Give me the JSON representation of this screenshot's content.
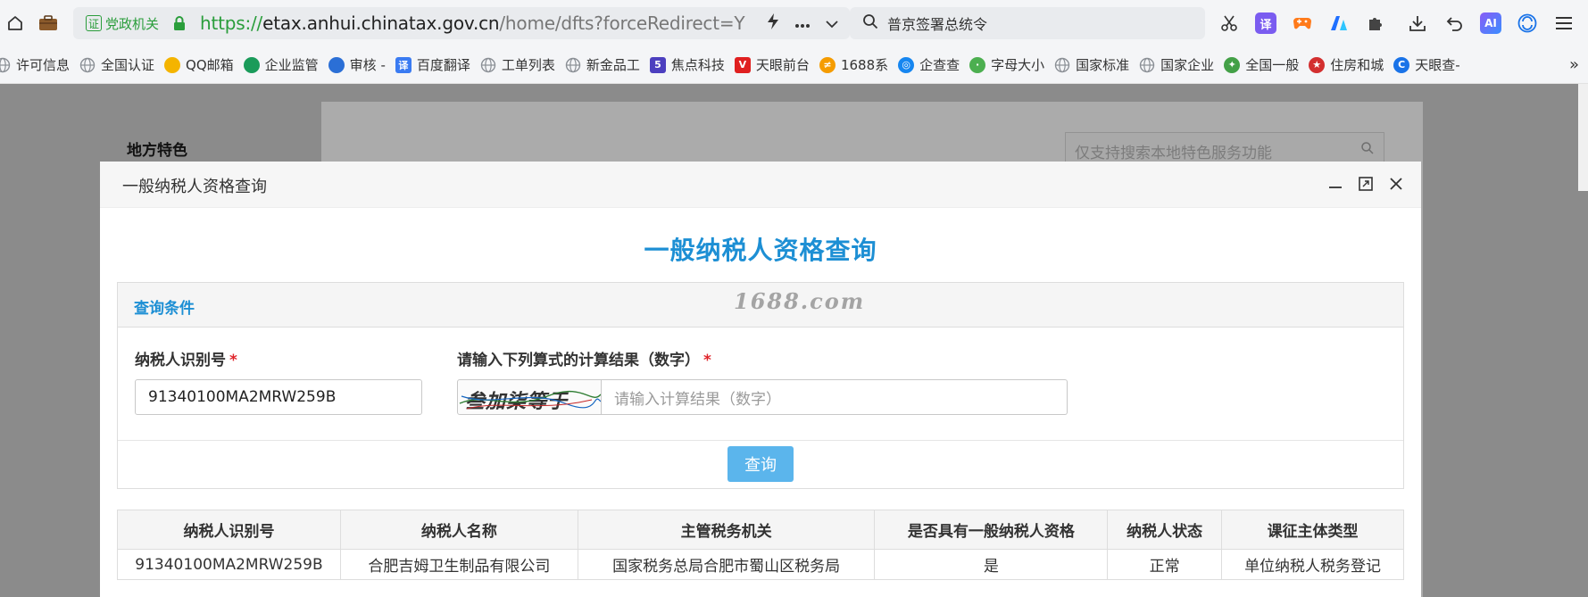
{
  "browser": {
    "cert_label": "党政机关",
    "cert_badge": "证",
    "url": {
      "scheme": "https://",
      "host": "etax.anhui.chinatax.gov.cn",
      "path": "/home/dfts?forceRedirect=Y"
    },
    "search_text": "普京签署总统令",
    "ext_translate": "译",
    "ext_ai": "AI",
    "bookmarks": [
      {
        "label": "许可信息",
        "icon": "globe-icon",
        "color": "#9aa0a6",
        "glyph": ""
      },
      {
        "label": "全国认证",
        "icon": "globe-icon",
        "color": "#9aa0a6",
        "glyph": ""
      },
      {
        "label": "QQ邮箱",
        "icon": "qq-mail-icon",
        "color": "#f4b400",
        "glyph": ""
      },
      {
        "label": "企业监管",
        "icon": "swirl-icon",
        "color": "#1a9b5a",
        "glyph": ""
      },
      {
        "label": "审核 -",
        "icon": "triangle-icon",
        "color": "#2b6fd6",
        "glyph": ""
      },
      {
        "label": "百度翻译",
        "icon": "translate-icon",
        "color": "#3a7bf2",
        "glyph": "译"
      },
      {
        "label": "工单列表",
        "icon": "globe-icon",
        "color": "#9aa0a6",
        "glyph": ""
      },
      {
        "label": "新金品工",
        "icon": "globe-icon",
        "color": "#9aa0a6",
        "glyph": ""
      },
      {
        "label": "焦点科技",
        "icon": "focus-icon",
        "color": "#4c3fbf",
        "glyph": "5"
      },
      {
        "label": "天眼前台",
        "icon": "v-icon",
        "color": "#e02020",
        "glyph": "V"
      },
      {
        "label": "1688系",
        "icon": "1688-icon",
        "color": "#f59c00",
        "glyph": "≠"
      },
      {
        "label": "企查查",
        "icon": "qcc-icon",
        "color": "#1686f0",
        "glyph": "◎"
      },
      {
        "label": "字母大小",
        "icon": "frog-icon",
        "color": "#4caf50",
        "glyph": "·"
      },
      {
        "label": "国家标准",
        "icon": "globe-icon",
        "color": "#9aa0a6",
        "glyph": ""
      },
      {
        "label": "国家企业",
        "icon": "globe-icon",
        "color": "#9aa0a6",
        "glyph": ""
      },
      {
        "label": "全国一般",
        "icon": "plant-icon",
        "color": "#43a047",
        "glyph": "✦"
      },
      {
        "label": "住房和城",
        "icon": "emblem-icon",
        "color": "#d32f2f",
        "glyph": "★"
      },
      {
        "label": "天眼查-",
        "icon": "tianyan-icon",
        "color": "#1a73e8",
        "glyph": "C"
      }
    ],
    "bookmarks_more": "»"
  },
  "background_page": {
    "side_title": "地方特色",
    "search_placeholder": "仅支持搜索本地特色服务功能"
  },
  "dialog": {
    "window_title": "一般纳税人资格查询",
    "heading": "一般纳税人资格查询",
    "panel_title": "查询条件",
    "watermark": "1688.com",
    "taxpayer_id_label": "纳税人识别号",
    "taxpayer_id_value": "91340100MA2MRW259B",
    "captcha_label": "请输入下列算式的计算结果（数字）",
    "captcha_image_text": "叁加柒等于",
    "captcha_placeholder": "请输入计算结果（数字）",
    "required_mark": "*",
    "query_button": "查询",
    "accent_color": "#1d8fd4"
  },
  "result_table": {
    "headers": [
      "纳税人识别号",
      "纳税人名称",
      "主管税务机关",
      "是否具有一般纳税人资格",
      "纳税人状态",
      "课征主体类型"
    ],
    "rows": [
      [
        "91340100MA2MRW259B",
        "合肥吉姆卫生制品有限公司",
        "国家税务总局合肥市蜀山区税务局",
        "是",
        "正常",
        "单位纳税人税务登记"
      ]
    ]
  }
}
